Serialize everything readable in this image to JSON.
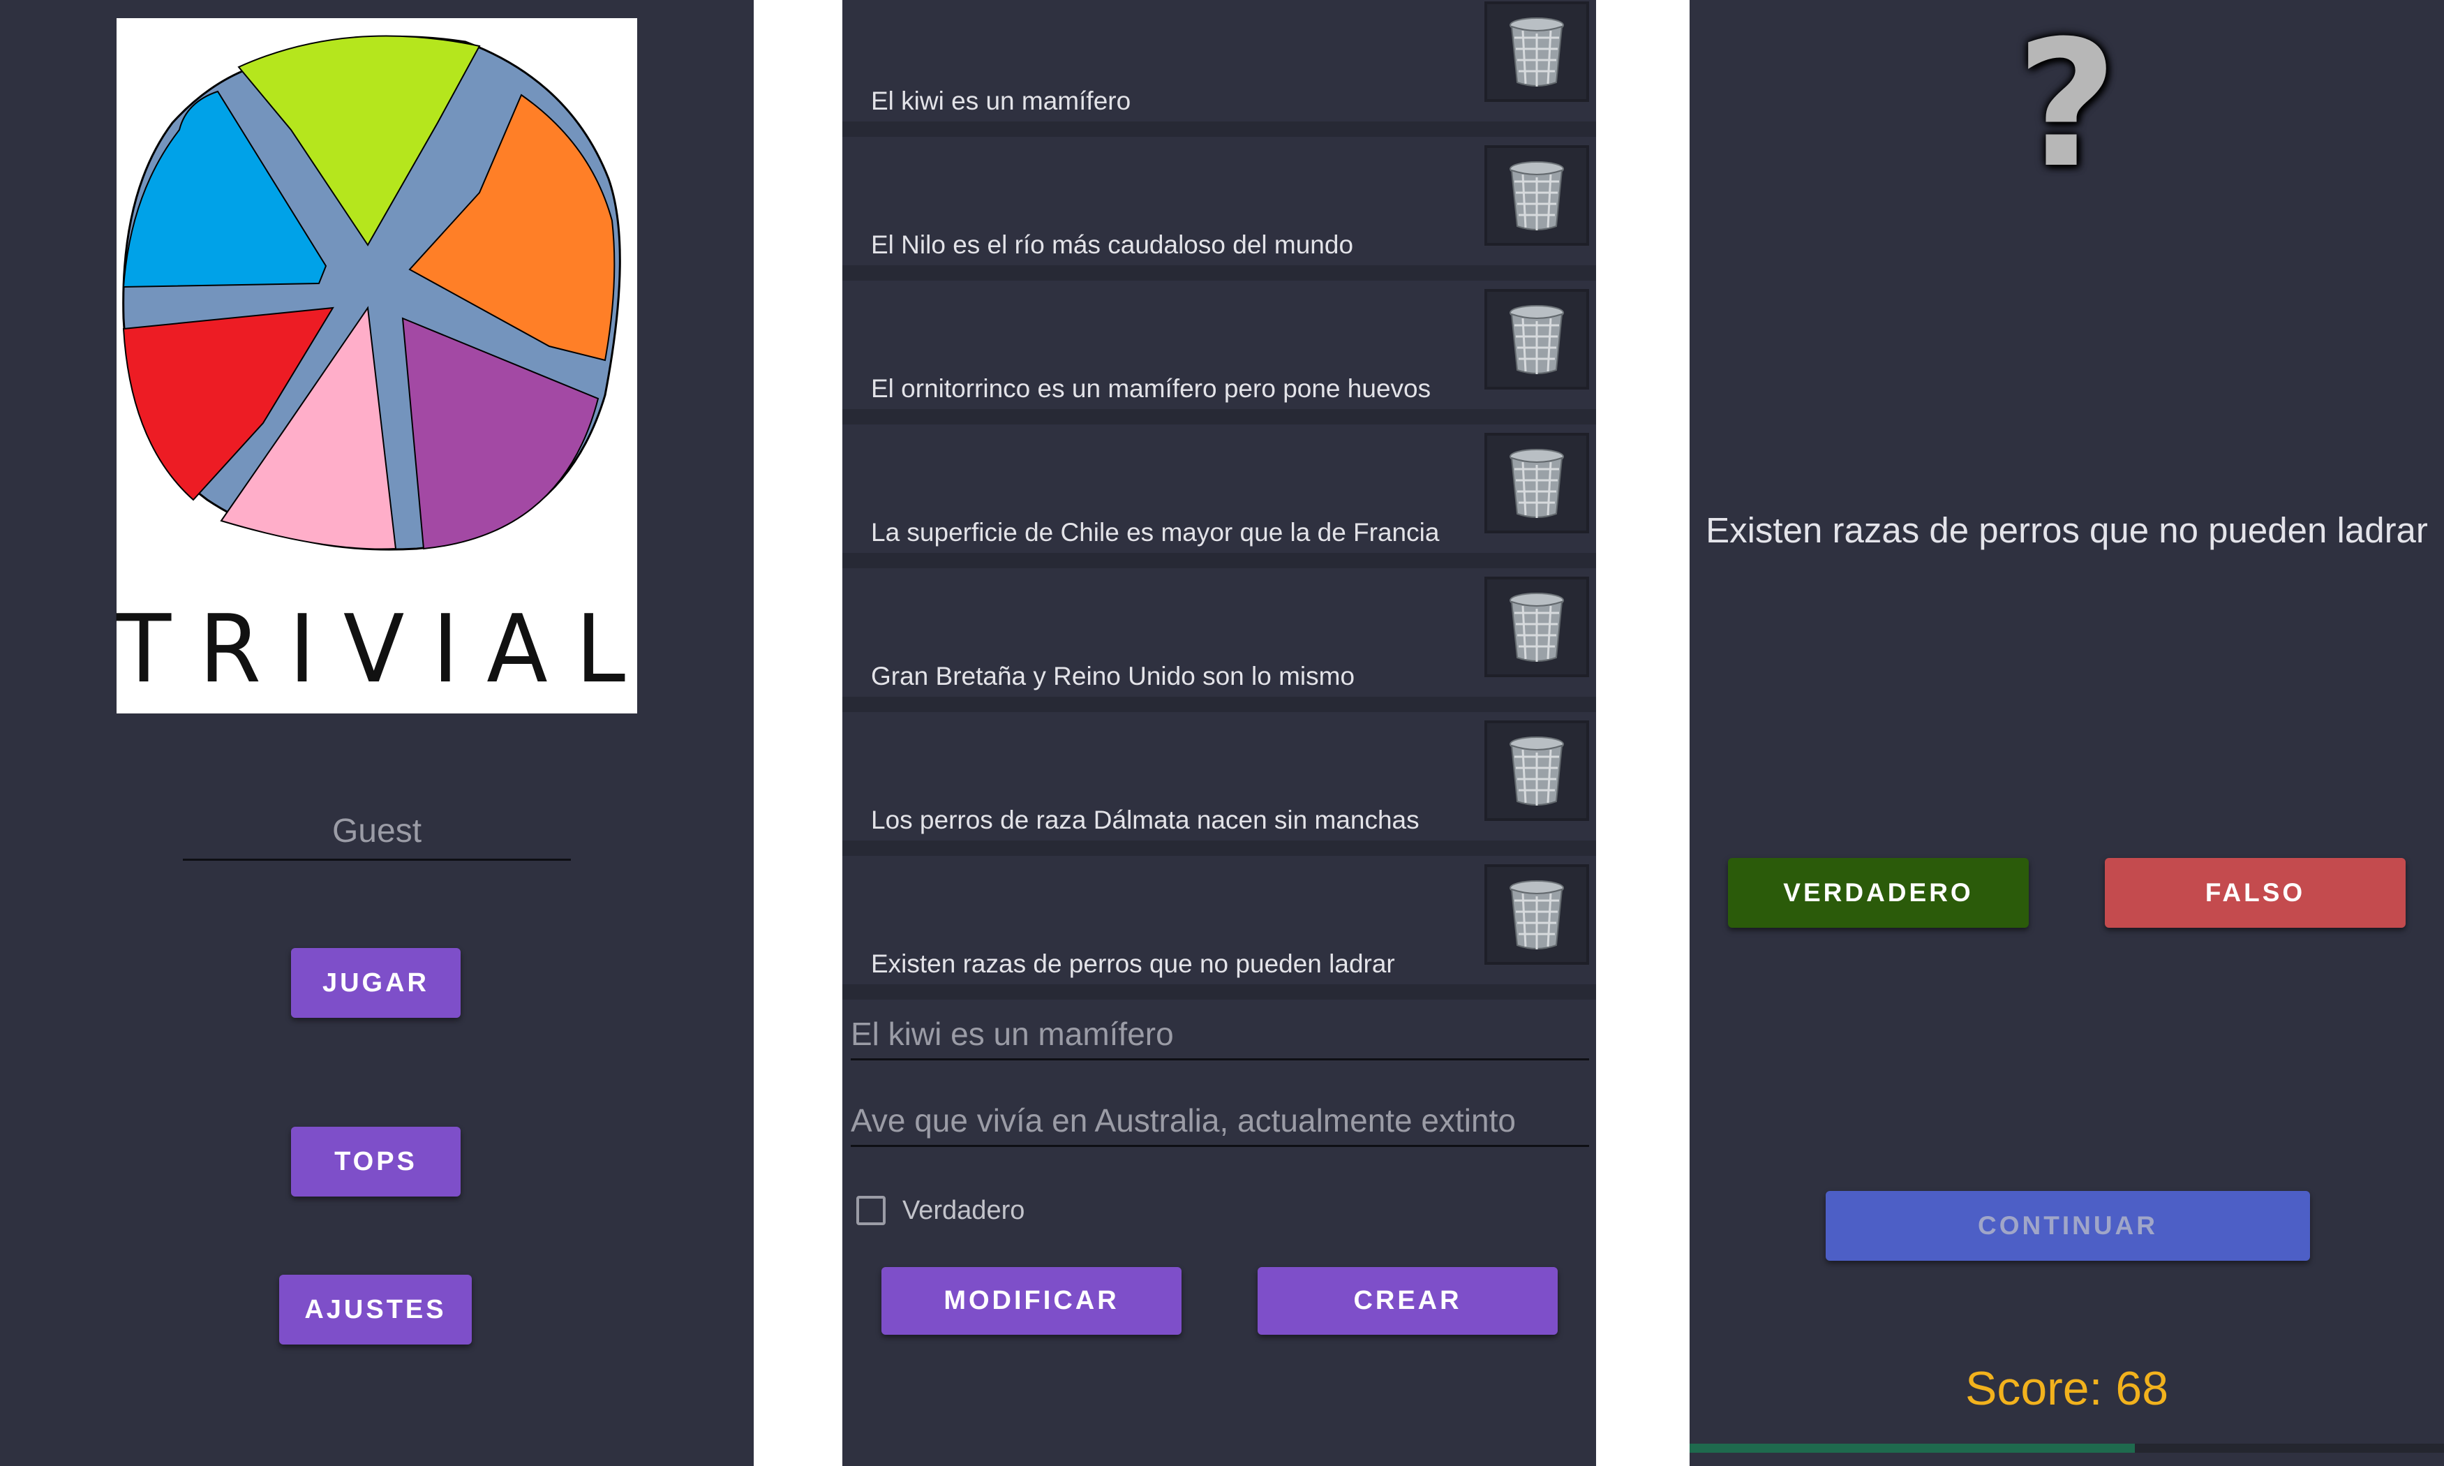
{
  "menu_screen": {
    "logo_text": "TRIVIAL",
    "name_input_value": "Guest",
    "buttons": {
      "play": "JUGAR",
      "tops": "TOPS",
      "settings": "AJUSTES"
    }
  },
  "edit_screen": {
    "questions": [
      "El kiwi es un mamífero",
      "El Nilo es el río más caudaloso del mundo",
      "El ornitorrinco es un mamífero pero pone huevos",
      "La superficie de Chile es mayor que la de Francia",
      "Gran Bretaña y Reino Unido son lo mismo",
      "Los perros de raza Dálmata nacen sin manchas",
      "Existen razas de perros que no pueden ladrar"
    ],
    "question_field_value": "El kiwi es un mamífero",
    "hint_field_value": "Ave que vivía en Australia, actualmente extinto",
    "checkbox_label": "Verdadero",
    "checkbox_checked": false,
    "buttons": {
      "modify": "MODIFICAR",
      "create": "CREAR"
    }
  },
  "game_screen": {
    "question_mark": "?",
    "question": "Existen razas de perros que no pueden ladrar",
    "buttons": {
      "true": "VERDADERO",
      "false": "FALSO",
      "continue": "CONTINUAR"
    },
    "score_text": "Score: 68",
    "progress_fraction": 0.59
  },
  "colors": {
    "background": "#2f3140",
    "primary_button": "#7e4fc9",
    "true_button": "#2b5b0a",
    "false_button": "#c44b4e",
    "continue_button": "#4d5fc6",
    "score": "#f2b21d"
  }
}
